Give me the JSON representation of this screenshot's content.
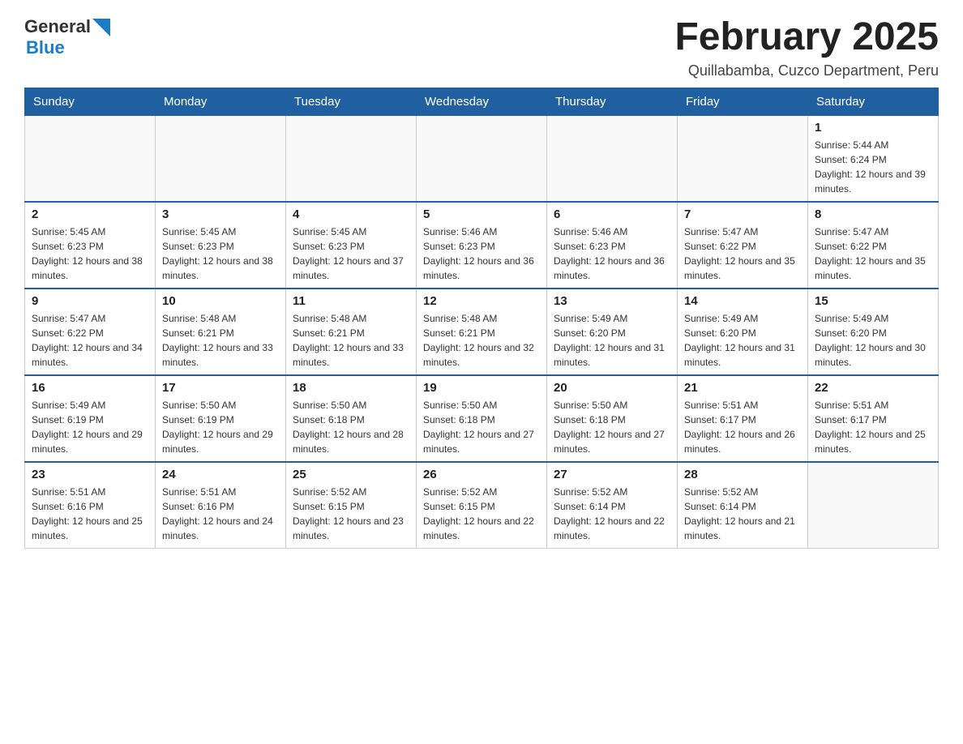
{
  "header": {
    "logo": {
      "text_general": "General",
      "text_blue": "Blue",
      "aria": "GeneralBlue logo"
    },
    "title": "February 2025",
    "location": "Quillabamba, Cuzco Department, Peru"
  },
  "calendar": {
    "days_of_week": [
      "Sunday",
      "Monday",
      "Tuesday",
      "Wednesday",
      "Thursday",
      "Friday",
      "Saturday"
    ],
    "weeks": [
      {
        "days": [
          {
            "date": "",
            "info": ""
          },
          {
            "date": "",
            "info": ""
          },
          {
            "date": "",
            "info": ""
          },
          {
            "date": "",
            "info": ""
          },
          {
            "date": "",
            "info": ""
          },
          {
            "date": "",
            "info": ""
          },
          {
            "date": "1",
            "info": "Sunrise: 5:44 AM\nSunset: 6:24 PM\nDaylight: 12 hours and 39 minutes."
          }
        ]
      },
      {
        "days": [
          {
            "date": "2",
            "info": "Sunrise: 5:45 AM\nSunset: 6:23 PM\nDaylight: 12 hours and 38 minutes."
          },
          {
            "date": "3",
            "info": "Sunrise: 5:45 AM\nSunset: 6:23 PM\nDaylight: 12 hours and 38 minutes."
          },
          {
            "date": "4",
            "info": "Sunrise: 5:45 AM\nSunset: 6:23 PM\nDaylight: 12 hours and 37 minutes."
          },
          {
            "date": "5",
            "info": "Sunrise: 5:46 AM\nSunset: 6:23 PM\nDaylight: 12 hours and 36 minutes."
          },
          {
            "date": "6",
            "info": "Sunrise: 5:46 AM\nSunset: 6:23 PM\nDaylight: 12 hours and 36 minutes."
          },
          {
            "date": "7",
            "info": "Sunrise: 5:47 AM\nSunset: 6:22 PM\nDaylight: 12 hours and 35 minutes."
          },
          {
            "date": "8",
            "info": "Sunrise: 5:47 AM\nSunset: 6:22 PM\nDaylight: 12 hours and 35 minutes."
          }
        ]
      },
      {
        "days": [
          {
            "date": "9",
            "info": "Sunrise: 5:47 AM\nSunset: 6:22 PM\nDaylight: 12 hours and 34 minutes."
          },
          {
            "date": "10",
            "info": "Sunrise: 5:48 AM\nSunset: 6:21 PM\nDaylight: 12 hours and 33 minutes."
          },
          {
            "date": "11",
            "info": "Sunrise: 5:48 AM\nSunset: 6:21 PM\nDaylight: 12 hours and 33 minutes."
          },
          {
            "date": "12",
            "info": "Sunrise: 5:48 AM\nSunset: 6:21 PM\nDaylight: 12 hours and 32 minutes."
          },
          {
            "date": "13",
            "info": "Sunrise: 5:49 AM\nSunset: 6:20 PM\nDaylight: 12 hours and 31 minutes."
          },
          {
            "date": "14",
            "info": "Sunrise: 5:49 AM\nSunset: 6:20 PM\nDaylight: 12 hours and 31 minutes."
          },
          {
            "date": "15",
            "info": "Sunrise: 5:49 AM\nSunset: 6:20 PM\nDaylight: 12 hours and 30 minutes."
          }
        ]
      },
      {
        "days": [
          {
            "date": "16",
            "info": "Sunrise: 5:49 AM\nSunset: 6:19 PM\nDaylight: 12 hours and 29 minutes."
          },
          {
            "date": "17",
            "info": "Sunrise: 5:50 AM\nSunset: 6:19 PM\nDaylight: 12 hours and 29 minutes."
          },
          {
            "date": "18",
            "info": "Sunrise: 5:50 AM\nSunset: 6:18 PM\nDaylight: 12 hours and 28 minutes."
          },
          {
            "date": "19",
            "info": "Sunrise: 5:50 AM\nSunset: 6:18 PM\nDaylight: 12 hours and 27 minutes."
          },
          {
            "date": "20",
            "info": "Sunrise: 5:50 AM\nSunset: 6:18 PM\nDaylight: 12 hours and 27 minutes."
          },
          {
            "date": "21",
            "info": "Sunrise: 5:51 AM\nSunset: 6:17 PM\nDaylight: 12 hours and 26 minutes."
          },
          {
            "date": "22",
            "info": "Sunrise: 5:51 AM\nSunset: 6:17 PM\nDaylight: 12 hours and 25 minutes."
          }
        ]
      },
      {
        "days": [
          {
            "date": "23",
            "info": "Sunrise: 5:51 AM\nSunset: 6:16 PM\nDaylight: 12 hours and 25 minutes."
          },
          {
            "date": "24",
            "info": "Sunrise: 5:51 AM\nSunset: 6:16 PM\nDaylight: 12 hours and 24 minutes."
          },
          {
            "date": "25",
            "info": "Sunrise: 5:52 AM\nSunset: 6:15 PM\nDaylight: 12 hours and 23 minutes."
          },
          {
            "date": "26",
            "info": "Sunrise: 5:52 AM\nSunset: 6:15 PM\nDaylight: 12 hours and 22 minutes."
          },
          {
            "date": "27",
            "info": "Sunrise: 5:52 AM\nSunset: 6:14 PM\nDaylight: 12 hours and 22 minutes."
          },
          {
            "date": "28",
            "info": "Sunrise: 5:52 AM\nSunset: 6:14 PM\nDaylight: 12 hours and 21 minutes."
          },
          {
            "date": "",
            "info": ""
          }
        ]
      }
    ]
  }
}
